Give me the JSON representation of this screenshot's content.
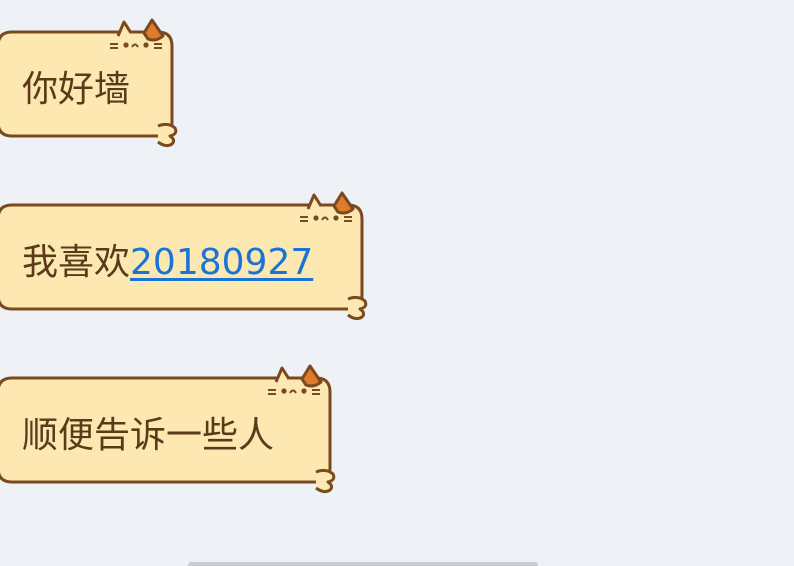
{
  "messages": [
    {
      "text": "你好墙"
    },
    {
      "text": "我喜欢",
      "link": "20180927"
    },
    {
      "text": "顺便告诉一些人"
    }
  ],
  "colors": {
    "bubble_fill": "#fde8b2",
    "bubble_outline": "#7a4a1e",
    "text": "#5b3a1a",
    "link": "#1a73d6",
    "cat_ear": "#e07a2c",
    "background": "#eef1f5"
  },
  "icons": {
    "bubble_decoration": "cat-icon"
  }
}
